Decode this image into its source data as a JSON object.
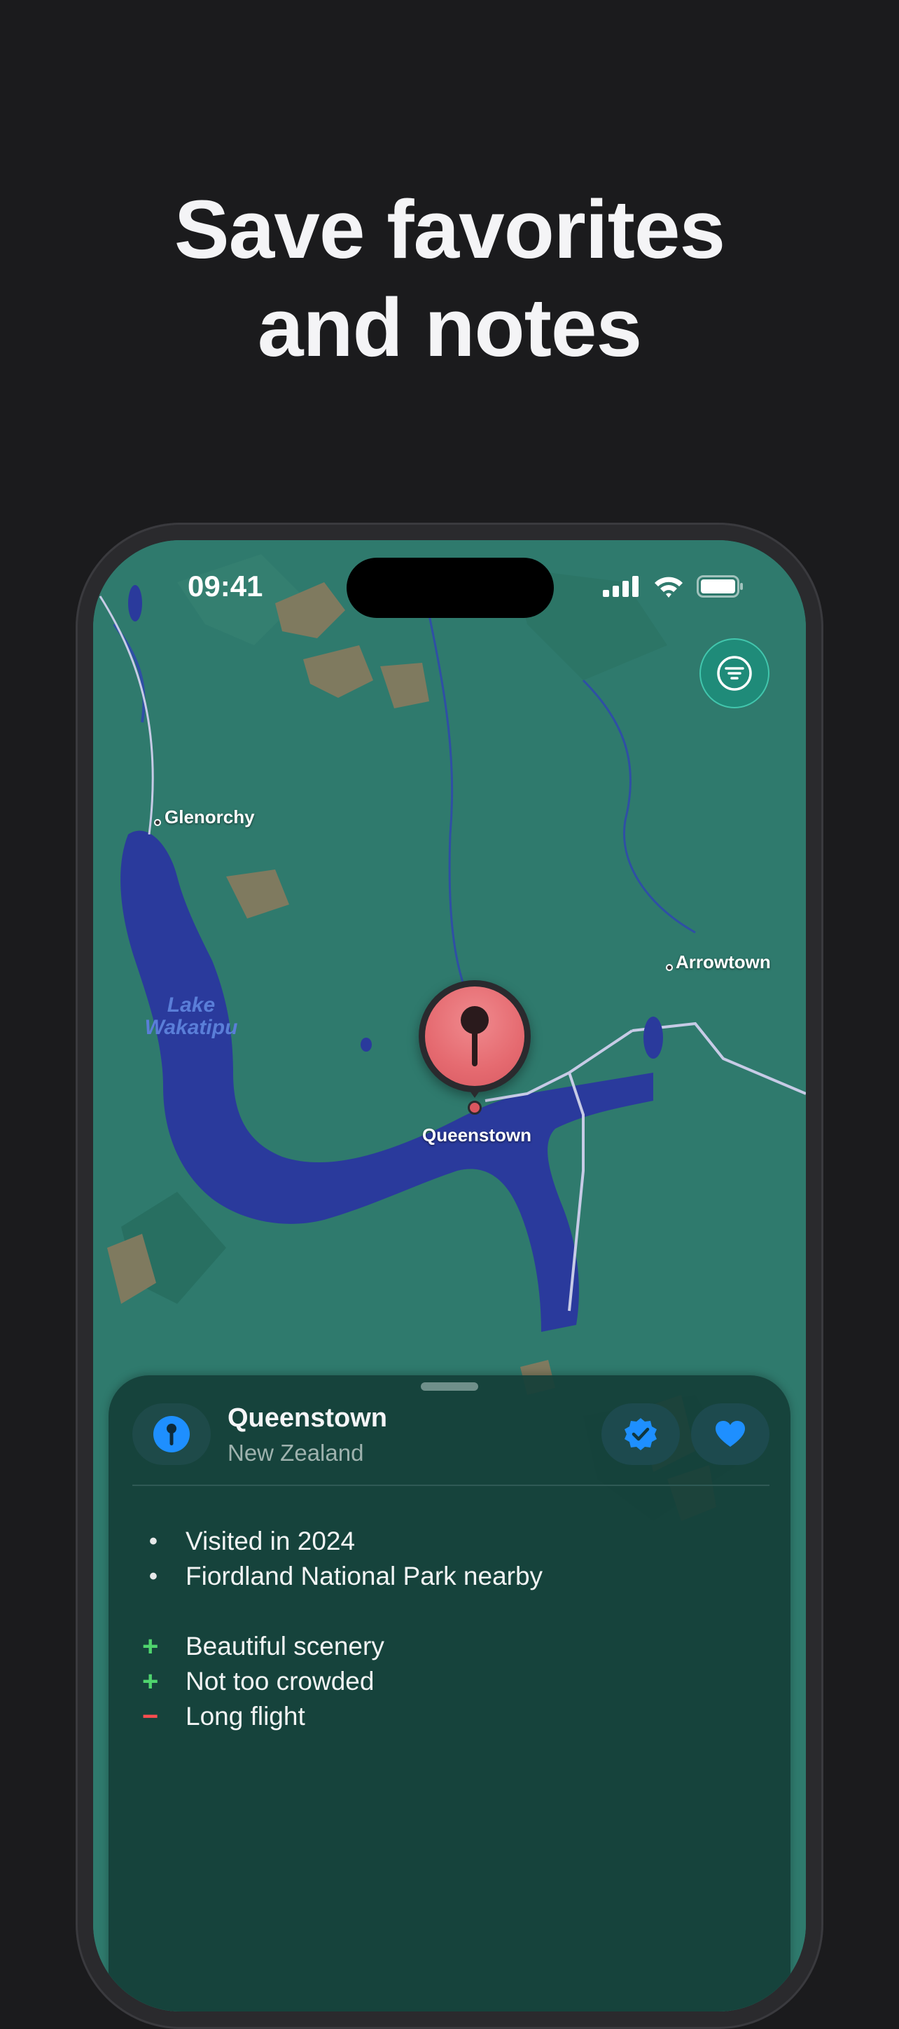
{
  "headline": {
    "line1": "Save favorites",
    "line2": "and notes"
  },
  "status_bar": {
    "time": "09:41"
  },
  "map": {
    "labels": {
      "glenorchy": "Glenorchy",
      "arrowtown": "Arrowtown",
      "lake_line1": "Lake",
      "lake_line2": "Wakatipu",
      "queenstown": "Queenstown"
    }
  },
  "place": {
    "title": "Queenstown",
    "subtitle": "New Zealand"
  },
  "notes": {
    "bullets": [
      "Visited in 2024",
      "Fiordland National Park nearby"
    ],
    "pros": [
      "Beautiful scenery",
      "Not too crowded"
    ],
    "cons": [
      "Long flight"
    ],
    "marks": {
      "bullet": "•",
      "plus": "+",
      "minus": "−"
    }
  },
  "colors": {
    "accent_blue": "#1e8fff",
    "pin_red": "#e56a70",
    "pro_green": "#4fd46e",
    "con_red": "#ff4d4f",
    "map_land": "#2f7a6d",
    "lake_blue": "#2a3a9c"
  },
  "icons": {
    "filter": "filter-icon",
    "pin": "pin-icon",
    "verified": "verified-badge-icon",
    "favorite": "heart-icon"
  }
}
